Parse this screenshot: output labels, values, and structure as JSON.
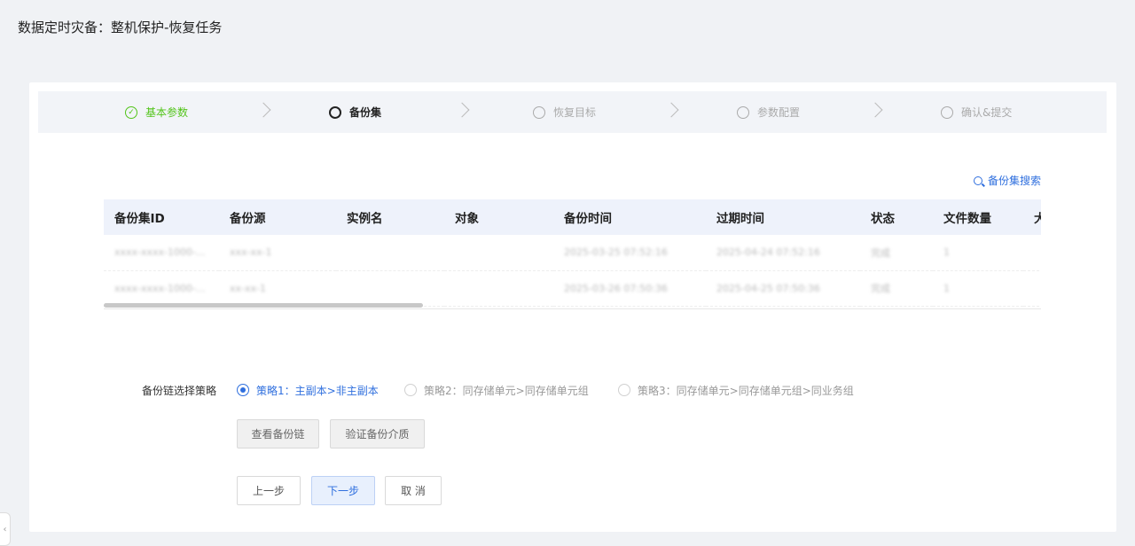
{
  "page_title": "数据定时灾备：整机保护-恢复任务",
  "steps": [
    {
      "label": "基本参数",
      "state": "done"
    },
    {
      "label": "备份集",
      "state": "active"
    },
    {
      "label": "恢复目标",
      "state": "pending"
    },
    {
      "label": "参数配置",
      "state": "pending"
    },
    {
      "label": "确认&提交",
      "state": "pending"
    }
  ],
  "search_link": "备份集搜索",
  "table": {
    "columns": [
      "备份集ID",
      "备份源",
      "实例名",
      "对象",
      "备份时间",
      "过期时间",
      "状态",
      "文件数量",
      "大"
    ],
    "rows": [
      [
        "xxxx-xxxx-1000-...",
        "xxx-xx-1",
        "",
        "",
        "2025-03-25 07:52:16",
        "2025-04-24 07:52:16",
        "完成",
        "1",
        ""
      ],
      [
        "xxxx-xxxx-1000-...",
        "xx-xx-1",
        "",
        "",
        "2025-03-26 07:50:36",
        "2025-04-25 07:50:36",
        "完成",
        "1",
        ""
      ]
    ]
  },
  "strategy": {
    "label": "备份链选择策略",
    "options": [
      {
        "label": "策略1：主副本>非主副本",
        "checked": true
      },
      {
        "label": "策略2：同存储单元>同存储单元组",
        "checked": false
      },
      {
        "label": "策略3：同存储单元>同存储单元组>同业务组",
        "checked": false
      }
    ]
  },
  "buttons": {
    "view_chain": "查看备份链",
    "verify_media": "验证备份介质",
    "prev": "上一步",
    "next": "下一步",
    "cancel": "取 消"
  },
  "side_tab_icon": "chevron-left-icon"
}
